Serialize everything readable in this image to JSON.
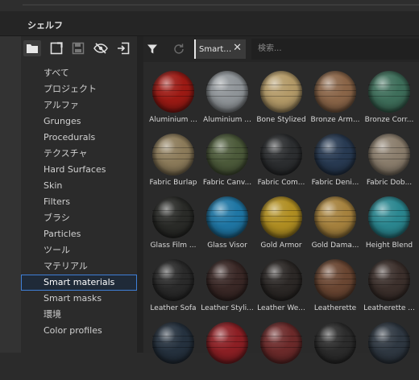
{
  "panel": {
    "title": "シェルフ"
  },
  "icon_bar": [
    "folder-icon",
    "new-tab-icon",
    "save-icon",
    "visibility-off-icon",
    "import-icon"
  ],
  "categories": [
    {
      "label": "すべて"
    },
    {
      "label": "プロジェクト"
    },
    {
      "label": "アルファ"
    },
    {
      "label": "Grunges"
    },
    {
      "label": "Procedurals"
    },
    {
      "label": "テクスチャ"
    },
    {
      "label": "Hard Surfaces"
    },
    {
      "label": "Skin"
    },
    {
      "label": "Filters"
    },
    {
      "label": "ブラシ"
    },
    {
      "label": "Particles"
    },
    {
      "label": "ツール"
    },
    {
      "label": "マテリアル"
    },
    {
      "label": "Smart materials",
      "selected": true
    },
    {
      "label": "Smart masks"
    },
    {
      "label": "環境"
    },
    {
      "label": "Color profiles"
    }
  ],
  "toolbar": {
    "filter_chip": {
      "label": "Smart…",
      "close": "✕"
    },
    "search": {
      "placeholder": "検索..."
    }
  },
  "materials": [
    {
      "name": "Aluminium ...",
      "color": "#9c1a14"
    },
    {
      "name": "Aluminium ...",
      "color": "#8f9498"
    },
    {
      "name": "Bone Stylized",
      "color": "#b39a68"
    },
    {
      "name": "Bronze Arm...",
      "color": "#8a6548"
    },
    {
      "name": "Bronze Corr...",
      "color": "#3e6e5a"
    },
    {
      "name": "Fabric Burlap",
      "color": "#8c7b5a"
    },
    {
      "name": "Fabric Canv...",
      "color": "#4c5a3a"
    },
    {
      "name": "Fabric Com...",
      "color": "#2c2e30"
    },
    {
      "name": "Fabric Deni...",
      "color": "#283a52"
    },
    {
      "name": "Fabric Dob...",
      "color": "#8a7d6c"
    },
    {
      "name": "Glass Film ...",
      "color": "#2a2b28"
    },
    {
      "name": "Glass Visor",
      "color": "#1f76a4"
    },
    {
      "name": "Gold Armor",
      "color": "#b08e22"
    },
    {
      "name": "Gold Dama...",
      "color": "#a6823e"
    },
    {
      "name": "Height Blend",
      "color": "#2b8790"
    },
    {
      "name": "Leather Sofa",
      "color": "#2a2a2a"
    },
    {
      "name": "Leather Styli...",
      "color": "#3a2826"
    },
    {
      "name": "Leather We...",
      "color": "#2c2826"
    },
    {
      "name": "Leatherette",
      "color": "#6a4632"
    },
    {
      "name": "Leatherette ...",
      "color": "#3c302c"
    },
    {
      "name": "",
      "color": "#25313e"
    },
    {
      "name": "",
      "color": "#8c1f24"
    },
    {
      "name": "",
      "color": "#6c2a2a"
    },
    {
      "name": "",
      "color": "#2c2c2c"
    },
    {
      "name": "",
      "color": "#2f3842"
    }
  ]
}
